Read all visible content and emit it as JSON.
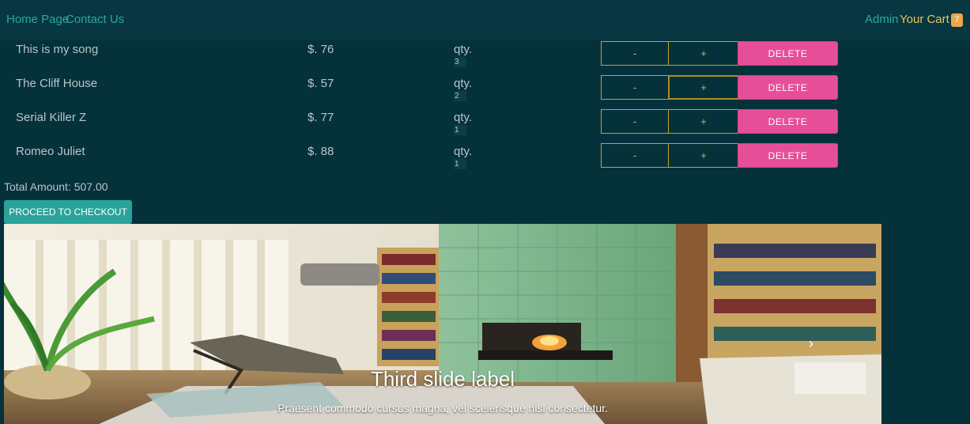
{
  "nav": {
    "home": "Home Page",
    "contact": "Contact Us",
    "admin": "Admin",
    "cart": "Your Cart",
    "cart_count": "7"
  },
  "cart": {
    "qty_label": "qty.",
    "minus_label": "-",
    "plus_label": "+",
    "delete_label": "DELETE",
    "items": [
      {
        "title": "This is my song",
        "price": "$. 76",
        "qty": "3"
      },
      {
        "title": "The Cliff House",
        "price": "$. 57",
        "qty": "2"
      },
      {
        "title": "Serial Killer Z",
        "price": "$. 77",
        "qty": "1"
      },
      {
        "title": "Romeo Juliet",
        "price": "$. 88",
        "qty": "1"
      }
    ]
  },
  "total": "Total Amount: 507.00",
  "checkout_label": "PROCEED TO CHECKOUT",
  "carousel": {
    "title": "Third slide label",
    "text": "Praesent commodo cursus magna, vel scelerisque nisl consectetur."
  },
  "colors": {
    "background": "#05313b",
    "navbar": "#083641",
    "nav_link": "#27a9a0",
    "cart_link": "#e6c35d",
    "badge": "#e9a84c",
    "delete": "#e64f97",
    "checkout": "#2aa39b",
    "qty_border": "#c9a227"
  },
  "icons": {
    "next": "chevron-right-icon"
  }
}
